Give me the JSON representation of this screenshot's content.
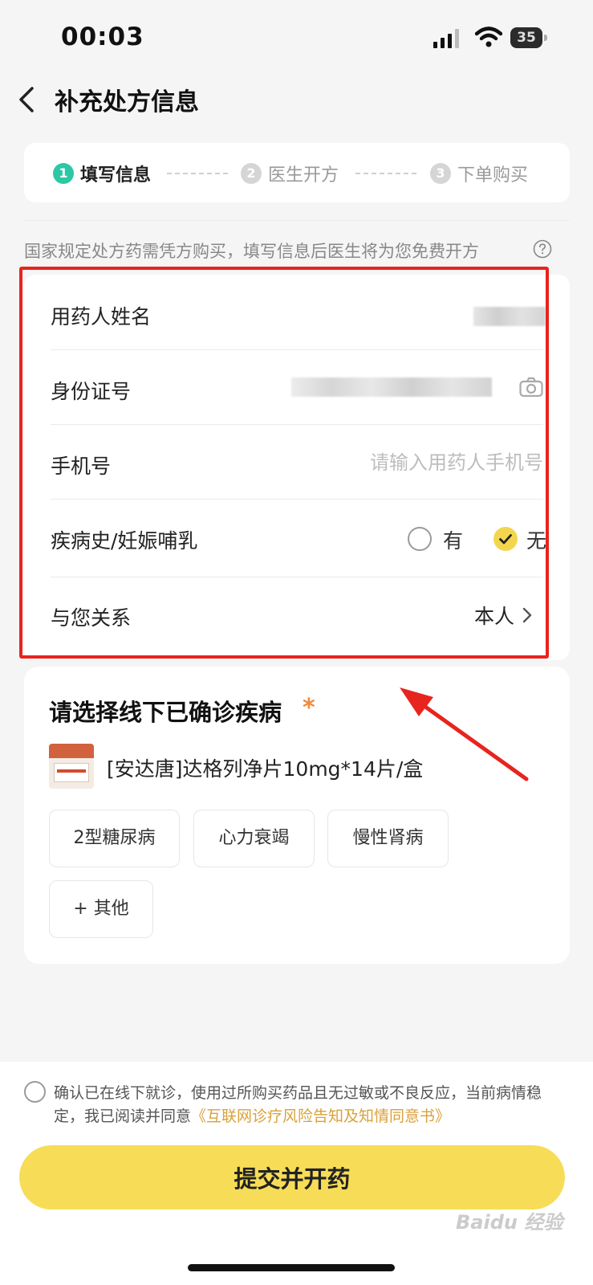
{
  "status_bar": {
    "time": "00:03",
    "battery": "35"
  },
  "header": {
    "title": "补充处方信息"
  },
  "steps": [
    {
      "num": "1",
      "label": "填写信息"
    },
    {
      "num": "2",
      "label": "医生开方"
    },
    {
      "num": "3",
      "label": "下单购买"
    }
  ],
  "notice": "国家规定处方药需凭方购买，填写信息后医生将为您免费开方",
  "form": {
    "name_label": "用药人姓名",
    "id_label": "身份证号",
    "phone_label": "手机号",
    "phone_placeholder": "请输入用药人手机号",
    "history_label": "疾病史/妊娠哺乳",
    "option_yes": "有",
    "option_no": "无",
    "selected_option": "无",
    "relation_label": "与您关系",
    "relation_value": "本人"
  },
  "disease": {
    "title": "请选择线下已确诊疾病",
    "required_mark": "*",
    "product_name": "[安达唐]达格列净片10mg*14片/盒",
    "tags": [
      "2型糖尿病",
      "心力衰竭",
      "慢性肾病",
      "+ 其他"
    ]
  },
  "agreement": {
    "text": "确认已在线下就诊，使用过所购买药品且无过敏或不良反应，当前病情稳定，我已阅读并同意",
    "link": "《互联网诊疗风险告知及知情同意书》"
  },
  "submit_label": "提交并开药",
  "watermark": "Baidu 经验",
  "colors": {
    "accent_yellow": "#f7dd57",
    "step_active": "#2cc7a4",
    "step_inactive": "#d5d5d5",
    "annotation_red": "#e8241e",
    "link": "#d9a13a"
  },
  "icons": [
    "signal-icon",
    "wifi-icon",
    "battery-icon",
    "back-arrow-icon",
    "help-icon",
    "camera-icon",
    "check-icon",
    "chevron-right-icon"
  ]
}
